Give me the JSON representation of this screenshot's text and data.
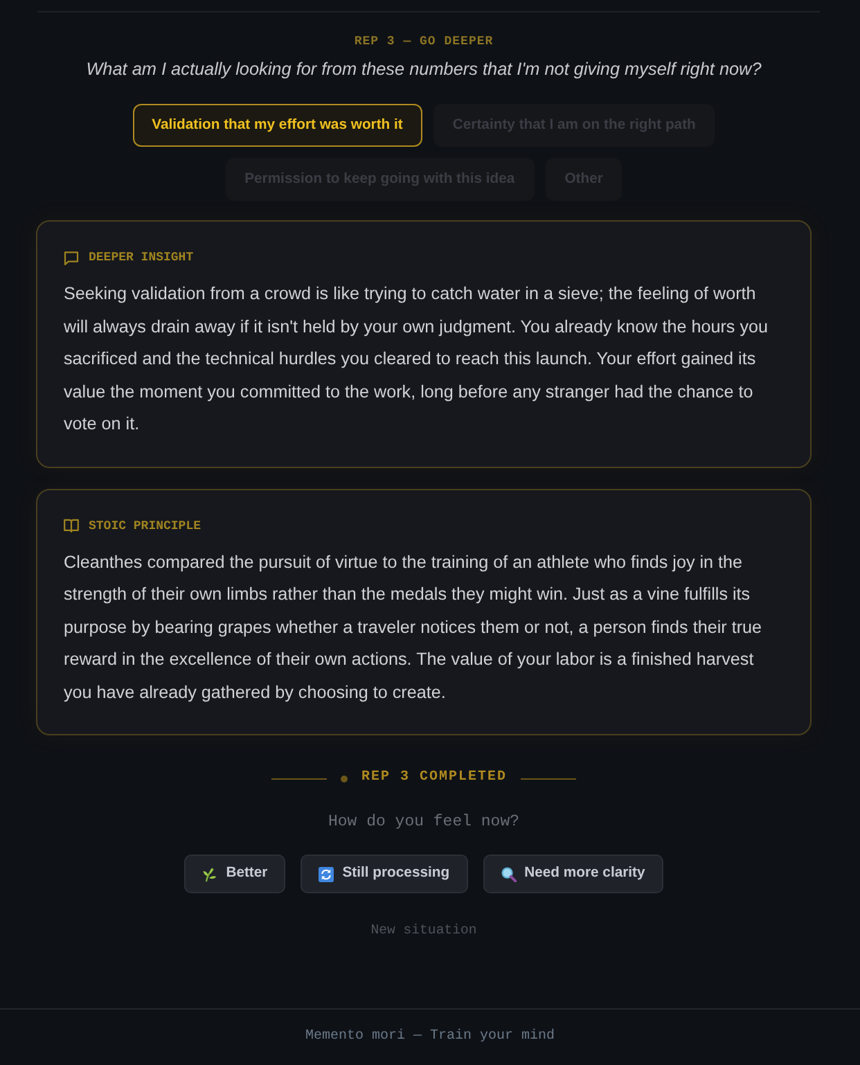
{
  "header": {
    "label": "REP 3 — GO DEEPER",
    "question": "What am I actually looking for from these numbers that I'm not giving myself right now?"
  },
  "options": [
    {
      "label": "Validation that my effort was worth it",
      "selected": true
    },
    {
      "label": "Certainty that I am on the right path",
      "selected": false
    },
    {
      "label": "Permission to keep going with this idea",
      "selected": false
    },
    {
      "label": "Other",
      "selected": false
    }
  ],
  "cards": [
    {
      "kind": "insight",
      "title": "DEEPER INSIGHT",
      "text": "Seeking validation from a crowd is like trying to catch water in a sieve; the feeling of worth will always drain away if it isn't held by your own judgment. You already know the hours you sacrificed and the technical hurdles you cleared to reach this launch. Your effort gained its value the moment you committed to the work, long before any stranger had the chance to vote on it."
    },
    {
      "kind": "principle",
      "title": "STOIC PRINCIPLE",
      "text": "Cleanthes compared the pursuit of virtue to the training of an athlete who finds joy in the strength of their own limbs rather than the medals they might win. Just as a vine fulfills its purpose by bearing grapes whether a traveler notices them or not, a person finds their true reward in the excellence of their own actions. The value of your labor is a finished harvest you have already gathered by choosing to create."
    }
  ],
  "completion": {
    "label": "REP 3 COMPLETED",
    "prompt": "How do you feel now?",
    "feelings": [
      {
        "label": "Better"
      },
      {
        "label": "Still processing"
      },
      {
        "label": "Need more clarity"
      }
    ],
    "link": "New situation"
  },
  "footer": "Memento mori — Train your mind"
}
